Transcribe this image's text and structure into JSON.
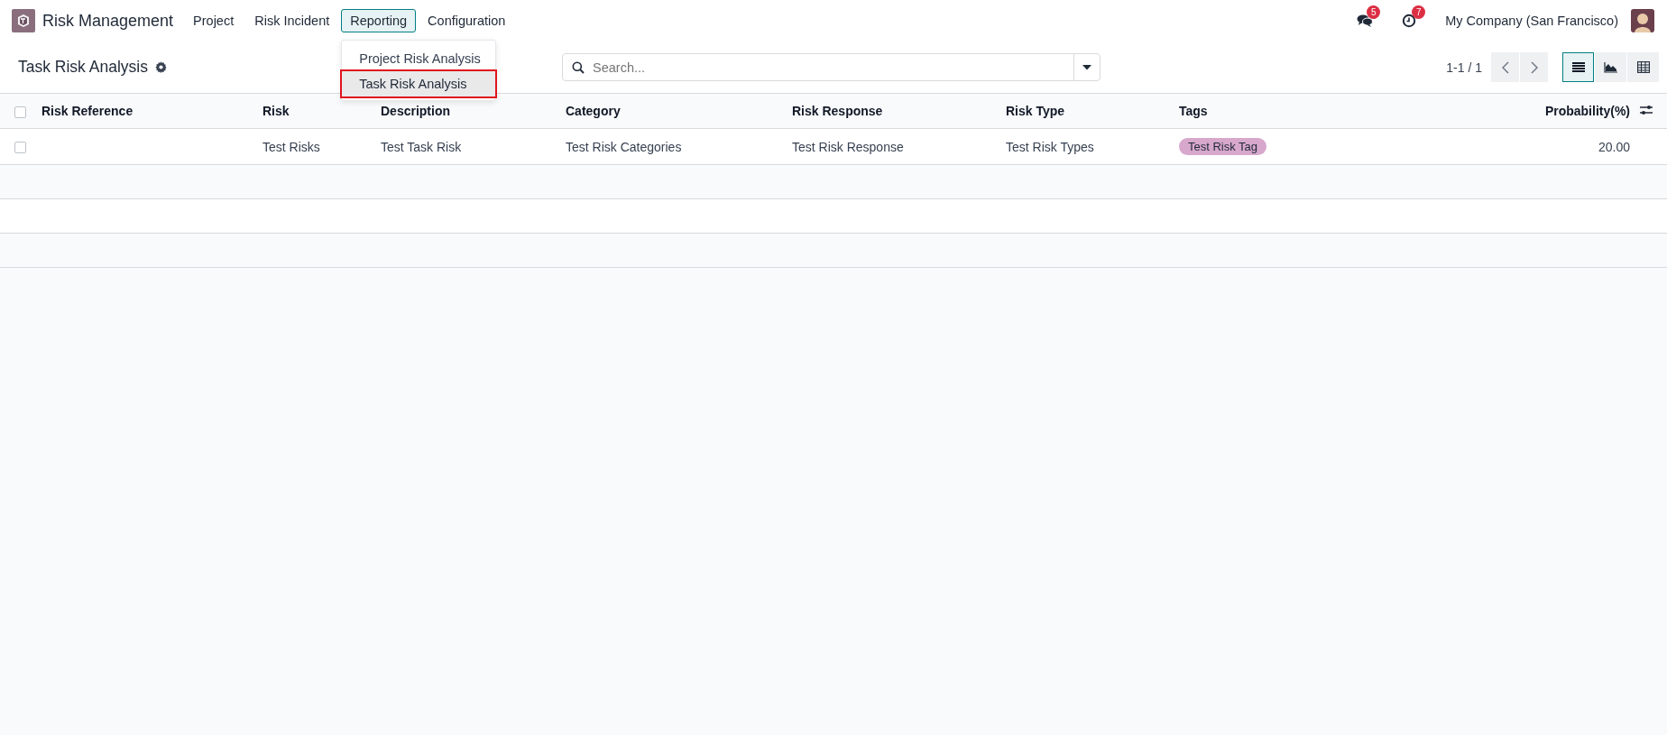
{
  "navbar": {
    "app_name": "Risk Management",
    "menu": [
      {
        "label": "Project",
        "selected": false
      },
      {
        "label": "Risk Incident",
        "selected": false
      },
      {
        "label": "Reporting",
        "selected": true
      },
      {
        "label": "Configuration",
        "selected": false
      }
    ],
    "dropdown": [
      {
        "label": "Project Risk Analysis",
        "selected": false
      },
      {
        "label": "Task Risk Analysis",
        "selected": true
      }
    ],
    "messages_count": "5",
    "activities_count": "7",
    "company": "My Company (San Francisco)"
  },
  "control_panel": {
    "title": "Task Risk Analysis",
    "search": {
      "placeholder": "Search..."
    },
    "pager": "1-1 / 1",
    "views": [
      {
        "kind": "list",
        "selected": true
      },
      {
        "kind": "graph",
        "selected": false
      },
      {
        "kind": "pivot",
        "selected": false
      }
    ]
  },
  "table": {
    "all_checked": false,
    "columns": [
      "Risk Reference",
      "Risk",
      "Description",
      "Category",
      "Risk Response",
      "Risk Type",
      "Tags",
      "Probability(%)"
    ],
    "rows": [
      {
        "checked": false,
        "risk_reference": "",
        "risk": "Test Risks",
        "description": "Test Task Risk",
        "category": "Test Risk Categories",
        "risk_response": "Test Risk Response",
        "risk_type": "Test Risk Types",
        "tags": [
          {
            "label": "Test Risk Tag",
            "color": "#d7a7cc"
          }
        ],
        "probability": "20.00"
      }
    ]
  }
}
